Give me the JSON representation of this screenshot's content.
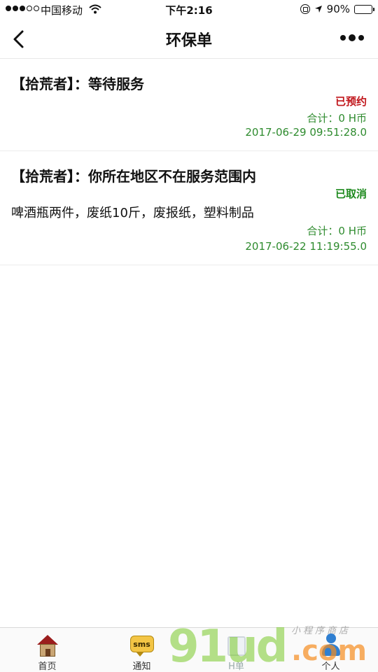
{
  "status_bar": {
    "carrier": "中国移动",
    "time": "下午2:16",
    "battery": "90%"
  },
  "nav": {
    "title": "环保单"
  },
  "orders": [
    {
      "title": "【拾荒者】：等待服务",
      "status": "已预约",
      "status_color": "#c0141a",
      "items": "",
      "total": "合计：0 H币",
      "time": "2017-06-29 09:51:28.0"
    },
    {
      "title": "【拾荒者】：你所在地区不在服务范围内",
      "status": "已取消",
      "status_color": "#1e8a1e",
      "items": "啤酒瓶两件，废纸10斤，废报纸，塑料制品",
      "total": "合计：0 H币",
      "time": "2017-06-22 11:19:55.0"
    }
  ],
  "tabs": [
    {
      "label": "首页",
      "icon": "home-icon"
    },
    {
      "label": "通知",
      "icon": "sms-icon",
      "icon_text": "sms"
    },
    {
      "label": "H单",
      "icon": "h-order-icon"
    },
    {
      "label": "个人",
      "icon": "person-icon"
    }
  ],
  "watermark": {
    "brand": "91ud",
    "domain": ".com",
    "tagline": "小程序商店"
  }
}
